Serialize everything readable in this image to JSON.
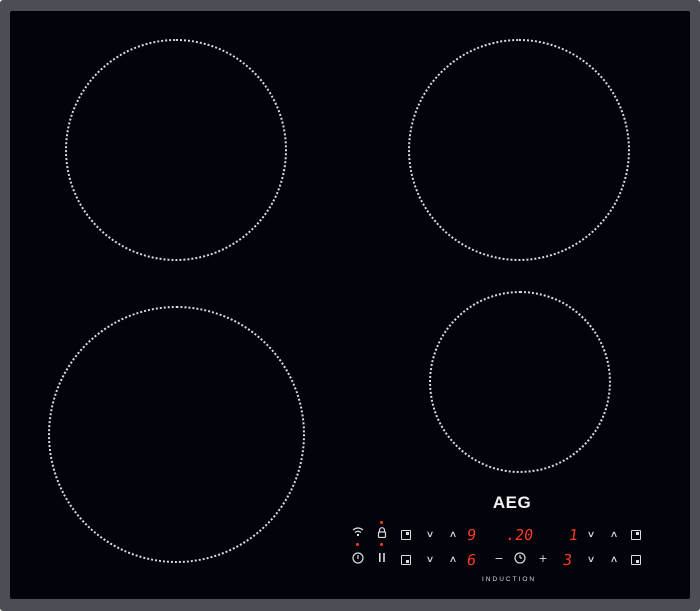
{
  "brand": {
    "logo": "AEG",
    "subtitle": "INDUCTION"
  },
  "colors": {
    "glass": "#03030b",
    "frame": "#4b4f55",
    "zone_outline": "#d9dbe0",
    "display": "#ff3b1f",
    "controls": "#dcdcdc"
  },
  "cooking_zones": [
    "front-left-zone",
    "rear-left-zone",
    "rear-right-zone",
    "front-right-zone"
  ],
  "controls": {
    "row1": {
      "hob2half": "wifi-icon",
      "lock": "lock-icon",
      "zone_select_left": "zone-select-icon",
      "down": "∨",
      "up": "∧",
      "level_left_rear": "9",
      "timer_display": ".20",
      "level_right_rear": "1",
      "down_right": "∨",
      "up_right": "∧",
      "zone_select_right": "zone-select-icon"
    },
    "row2": {
      "power": "ⓘ",
      "pause": "‖",
      "zone_select_left": "zone-select-icon",
      "down": "∨",
      "up": "∧",
      "level_left_front": "6",
      "minus": "−",
      "timer": "⏱",
      "plus": "+",
      "level_right_front": "3",
      "down_right": "∨",
      "up_right": "∧",
      "zone_select_right": "zone-select-icon"
    }
  }
}
